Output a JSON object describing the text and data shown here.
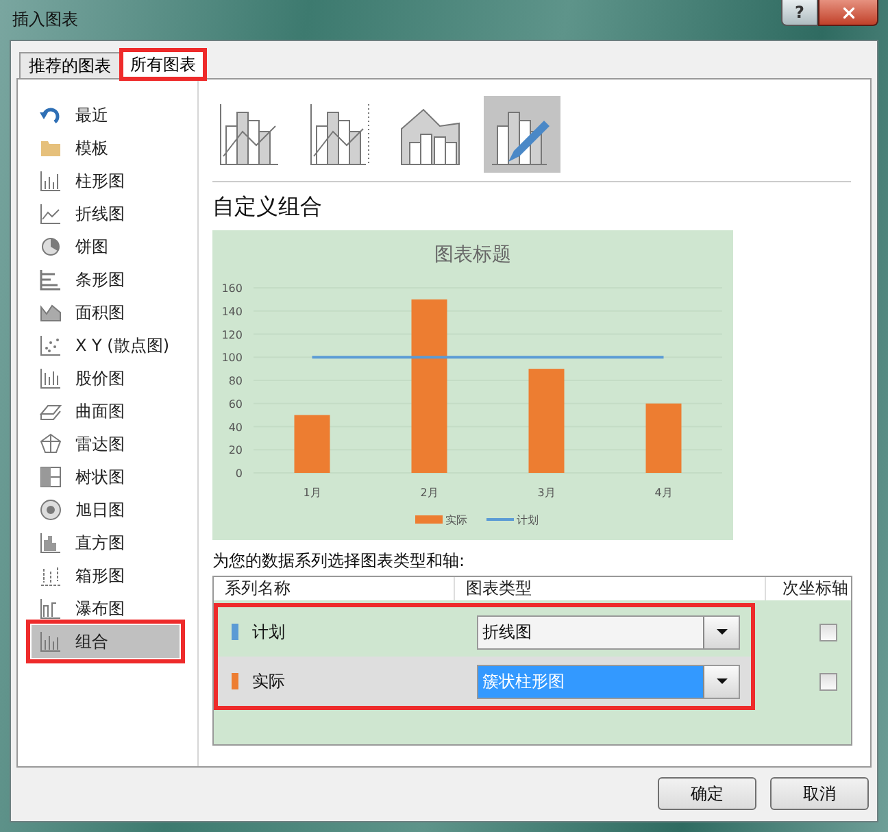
{
  "window": {
    "title": "插入图表",
    "help": "?"
  },
  "tabs": [
    {
      "label": "推荐的图表",
      "selected": false,
      "highlighted": false
    },
    {
      "label": "所有图表",
      "selected": true,
      "highlighted": true
    }
  ],
  "sidebar": {
    "items": [
      {
        "label": "最近",
        "selected": false,
        "highlighted": false
      },
      {
        "label": "模板",
        "selected": false,
        "highlighted": false
      },
      {
        "label": "柱形图",
        "selected": false,
        "highlighted": false
      },
      {
        "label": "折线图",
        "selected": false,
        "highlighted": false
      },
      {
        "label": "饼图",
        "selected": false,
        "highlighted": false
      },
      {
        "label": "条形图",
        "selected": false,
        "highlighted": false
      },
      {
        "label": "面积图",
        "selected": false,
        "highlighted": false
      },
      {
        "label": "X Y (散点图)",
        "selected": false,
        "highlighted": false
      },
      {
        "label": "股价图",
        "selected": false,
        "highlighted": false
      },
      {
        "label": "曲面图",
        "selected": false,
        "highlighted": false
      },
      {
        "label": "雷达图",
        "selected": false,
        "highlighted": false
      },
      {
        "label": "树状图",
        "selected": false,
        "highlighted": false
      },
      {
        "label": "旭日图",
        "selected": false,
        "highlighted": false
      },
      {
        "label": "直方图",
        "selected": false,
        "highlighted": false
      },
      {
        "label": "箱形图",
        "selected": false,
        "highlighted": false
      },
      {
        "label": "瀑布图",
        "selected": false,
        "highlighted": false
      },
      {
        "label": "组合",
        "selected": true,
        "highlighted": true
      }
    ]
  },
  "subtypes": [
    {
      "selected": false
    },
    {
      "selected": false
    },
    {
      "selected": false
    },
    {
      "selected": true
    }
  ],
  "heading": "自定义组合",
  "preview": {
    "chart_data": {
      "type": "bar",
      "title": "图表标题",
      "categories": [
        "1月",
        "2月",
        "3月",
        "4月"
      ],
      "ylim": [
        0,
        160
      ],
      "yticks": [
        0,
        20,
        40,
        60,
        80,
        100,
        120,
        140,
        160
      ],
      "series": [
        {
          "name": "实际",
          "color": "#ed7d31",
          "type": "bar",
          "values": [
            50,
            150,
            90,
            60
          ]
        },
        {
          "name": "计划",
          "color": "#5b9bd5",
          "type": "line",
          "values": [
            100,
            100,
            100,
            100
          ]
        }
      ],
      "grid": true,
      "legend": "bottom"
    }
  },
  "series_prompt": "为您的数据系列选择图表类型和轴:",
  "series_table": {
    "columns": [
      "系列名称",
      "图表类型",
      "次坐标轴"
    ],
    "highlighted": true,
    "rows": [
      {
        "name": "计划",
        "color": "#5b9bd5",
        "chart_type": "折线图",
        "selected": false,
        "secondary_axis": false
      },
      {
        "name": "实际",
        "color": "#ed7d31",
        "chart_type": "簇状柱形图",
        "selected": true,
        "secondary_axis": false
      }
    ]
  },
  "buttons": [
    "确定",
    "取消"
  ]
}
